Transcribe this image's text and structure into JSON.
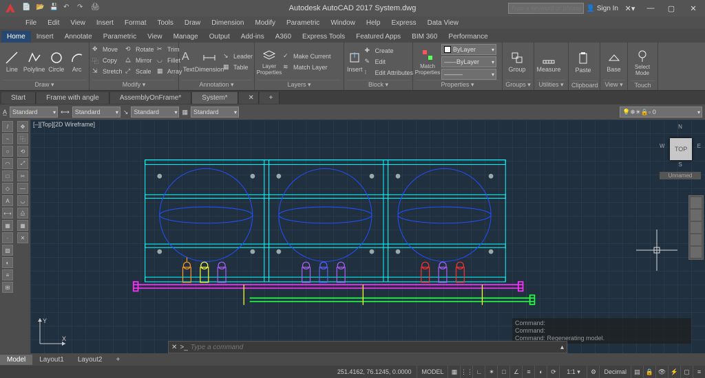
{
  "app": {
    "title": "Autodesk AutoCAD 2017    System.dwg",
    "search_placeholder": "Type a keyword or phrase",
    "signin": "Sign In"
  },
  "menus": [
    "File",
    "Edit",
    "View",
    "Insert",
    "Format",
    "Tools",
    "Draw",
    "Dimension",
    "Modify",
    "Parametric",
    "Window",
    "Help",
    "Express",
    "Data View"
  ],
  "ribbon_tabs": [
    "Home",
    "Insert",
    "Annotate",
    "Parametric",
    "View",
    "Manage",
    "Output",
    "Add-ins",
    "A360",
    "Express Tools",
    "Featured Apps",
    "BIM 360",
    "Performance"
  ],
  "ribbon_active": 0,
  "panels": {
    "draw": {
      "name": "Draw ▾",
      "btns": [
        "Line",
        "Polyline",
        "Circle",
        "Arc"
      ]
    },
    "modify": {
      "name": "Modify ▾",
      "items": [
        "Move",
        "Copy",
        "Stretch",
        "Rotate",
        "Mirror",
        "Scale",
        "Trim",
        "Fillet",
        "Array"
      ]
    },
    "annot": {
      "name": "Annotation ▾",
      "btns": [
        "Text",
        "Dimension"
      ],
      "items": [
        "Leader",
        "Table"
      ]
    },
    "layers": {
      "name": "Layers ▾",
      "btn": "Layer Properties",
      "items": [
        "Make Current",
        "Match Layer"
      ]
    },
    "block": {
      "name": "Block ▾",
      "btns": [
        "Insert"
      ],
      "items": [
        "Create",
        "Edit",
        "Edit Attributes"
      ]
    },
    "props": {
      "name": "Properties ▾",
      "btn": "Match Properties",
      "combo1": "ByLayer",
      "combo2": "ByLayer"
    },
    "groups": {
      "name": "Groups ▾",
      "btn": "Group"
    },
    "utils": {
      "name": "Utilities ▾",
      "btn": "Measure"
    },
    "clip": {
      "name": "Clipboard",
      "btn": "Paste"
    },
    "view": {
      "name": "View ▾",
      "btn": "Base"
    },
    "touch": {
      "name": "Touch",
      "btn": "Select Mode"
    }
  },
  "file_tabs": [
    "Start",
    "Frame with angle",
    "AssemblyOnFrame*",
    "System*"
  ],
  "file_active": 3,
  "layer_combo_vals": [
    "Standard",
    "Standard",
    "Standard",
    "Standard"
  ],
  "viewport_label": "[–][Top][2D Wireframe]",
  "viewcube": {
    "face": "TOP",
    "n": "N",
    "e": "E",
    "s": "S",
    "w": "W",
    "below": "Unnamed"
  },
  "ucs": {
    "x": "X",
    "y": "Y"
  },
  "cmd": {
    "hist": [
      "Command:",
      "Command:",
      "Command: Regenerating model."
    ],
    "placeholder": "Type a command",
    "prompt": ">_"
  },
  "model_tabs": [
    "Model",
    "Layout1",
    "Layout2"
  ],
  "model_active": 0,
  "status": {
    "coords": "251.4162, 76.1245, 0.0000",
    "model": "MODEL",
    "decimal": "Decimal"
  }
}
